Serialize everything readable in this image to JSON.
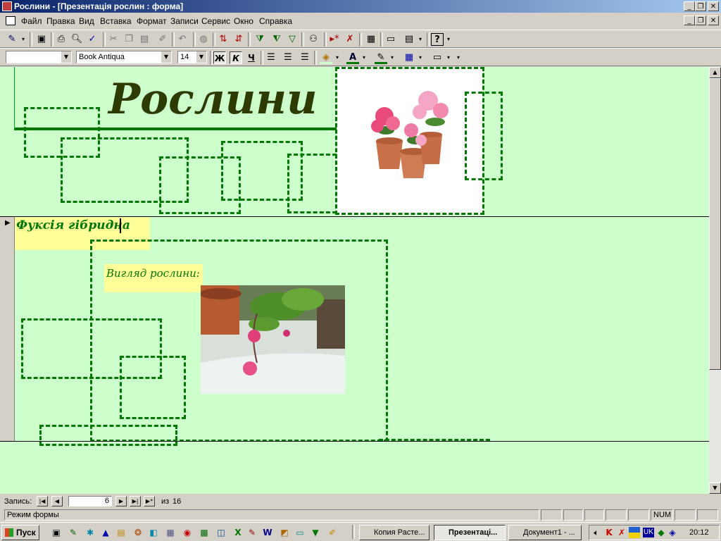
{
  "window": {
    "title": "Рослини - [Презентація рослин : форма]"
  },
  "menu": [
    "Файл",
    "Правка",
    "Вид",
    "Вставка",
    "Формат",
    "Записи",
    "Сервис",
    "Окно",
    "Справка"
  ],
  "format_toolbar": {
    "object": "",
    "font": "Book Antiqua",
    "size": "14",
    "bold": "Ж",
    "italic": "К",
    "underline": "Ч"
  },
  "form": {
    "header_title": "Рослини",
    "record_field": "Фуксія гібридна",
    "view_label": "Вигляд рослини:"
  },
  "record_nav": {
    "label": "Запись:",
    "current": "6",
    "of_label": "из",
    "total": "16"
  },
  "status": {
    "mode": "Режим формы",
    "num": "NUM"
  },
  "taskbar": {
    "start": "Пуск",
    "tasks": [
      "Копия Расте...",
      "Презентаці...",
      "Документ1 - ..."
    ],
    "lang": "UK",
    "clock": "20:12"
  },
  "colors": {
    "form_bg": "#ccffcc",
    "dash": "#007700",
    "title": "#2e3b00",
    "field_bg": "#ffff99"
  }
}
